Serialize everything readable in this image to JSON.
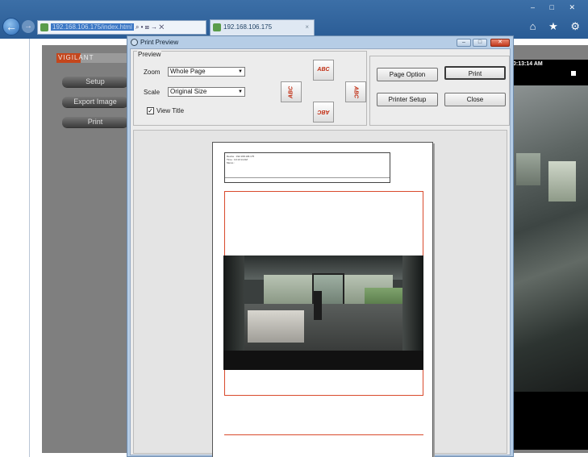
{
  "browser": {
    "address_text": "192.168.106.175/index.html",
    "search_hint": "⌕ • ⊠ → ✕",
    "tab_label": "192.168.106.175",
    "tab_close": "×",
    "window_controls": "– □ ✕",
    "nav_icons": "⌂ ★ ⚙"
  },
  "web": {
    "logo_text": "VIGILANT",
    "buttons": [
      "Setup",
      "Export Image",
      "Print"
    ],
    "camera_timestamp": "1 - 10:13:14 AM"
  },
  "dialog": {
    "title": "Print Preview",
    "minimize": "–",
    "maximize": "□",
    "close": "✕",
    "preview_group": "Preview",
    "zoom_label": "Zoom",
    "zoom_value": "Whole Page",
    "scale_label": "Scale",
    "scale_value": "Original Size",
    "view_title_label": "View Title",
    "view_title_checked": true,
    "check_mark": "✓",
    "orientation_text": "ABC",
    "buttons": {
      "page_option": "Page Option",
      "print": "Print",
      "printer_setup": "Printer Setup",
      "close": "Close"
    }
  },
  "sheet": {
    "header_lines": [
      "Device : 192.168.106.175",
      "Time : 10:13:14 AM",
      "Memo :"
    ]
  }
}
